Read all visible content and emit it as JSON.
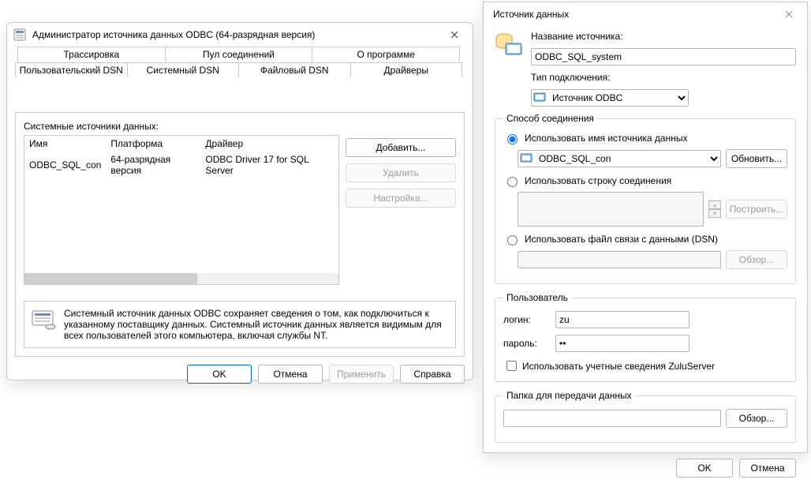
{
  "odbc": {
    "title": "Администратор источника данных ODBC (64-разрядная версия)",
    "tabs_top": [
      "Трассировка",
      "Пул соединений",
      "О программе"
    ],
    "tabs_bottom": [
      "Пользовательский DSN",
      "Системный DSN",
      "Файловый DSN",
      "Драйверы"
    ],
    "active_tab": "Системный DSN",
    "list_label": "Системные источники данных:",
    "columns": [
      "Имя",
      "Платформа",
      "Драйвер"
    ],
    "rows": [
      {
        "name": "ODBC_SQL_con",
        "platform": "64-разрядная версия",
        "driver": "ODBC Driver 17 for SQL Server"
      }
    ],
    "btn_add": "Добавить...",
    "btn_remove": "Удалить",
    "btn_config": "Настройка...",
    "info": "Системный источник данных ODBC сохраняет сведения о том, как подключиться к указанному поставщику данных.  Системный источник данных является видимым для всех пользователей этого компьютера, включая службы NT.",
    "btn_ok": "OK",
    "btn_cancel": "Отмена",
    "btn_apply": "Применить",
    "btn_help": "Справка"
  },
  "ds": {
    "title": "Источник данных",
    "name_label": "Название источника:",
    "name_value": "ODBC_SQL_system",
    "type_label": "Тип подключения:",
    "type_value": "Источник ODBC",
    "group_conn": "Способ соединения",
    "radio_dsn": "Использовать имя источника данных",
    "dsn_value": "ODBC_SQL_con",
    "btn_refresh": "Обновить...",
    "radio_connstr": "Использовать строку соединения",
    "connstr_value": "",
    "btn_build": "Построить...",
    "radio_file": "Использовать файл связи с данными (DSN)",
    "file_value": "",
    "btn_browse": "Обзор...",
    "group_user": "Пользователь",
    "login_label": "логин:",
    "login_value": "zu",
    "pwd_label": "пароль:",
    "pwd_value": "••",
    "chk_zulu": "Использовать учетные сведения ZuluServer",
    "group_folder": "Папка для передачи данных",
    "folder_value": "",
    "btn_browse2": "Обзор...",
    "btn_ok": "OK",
    "btn_cancel": "Отмена"
  }
}
